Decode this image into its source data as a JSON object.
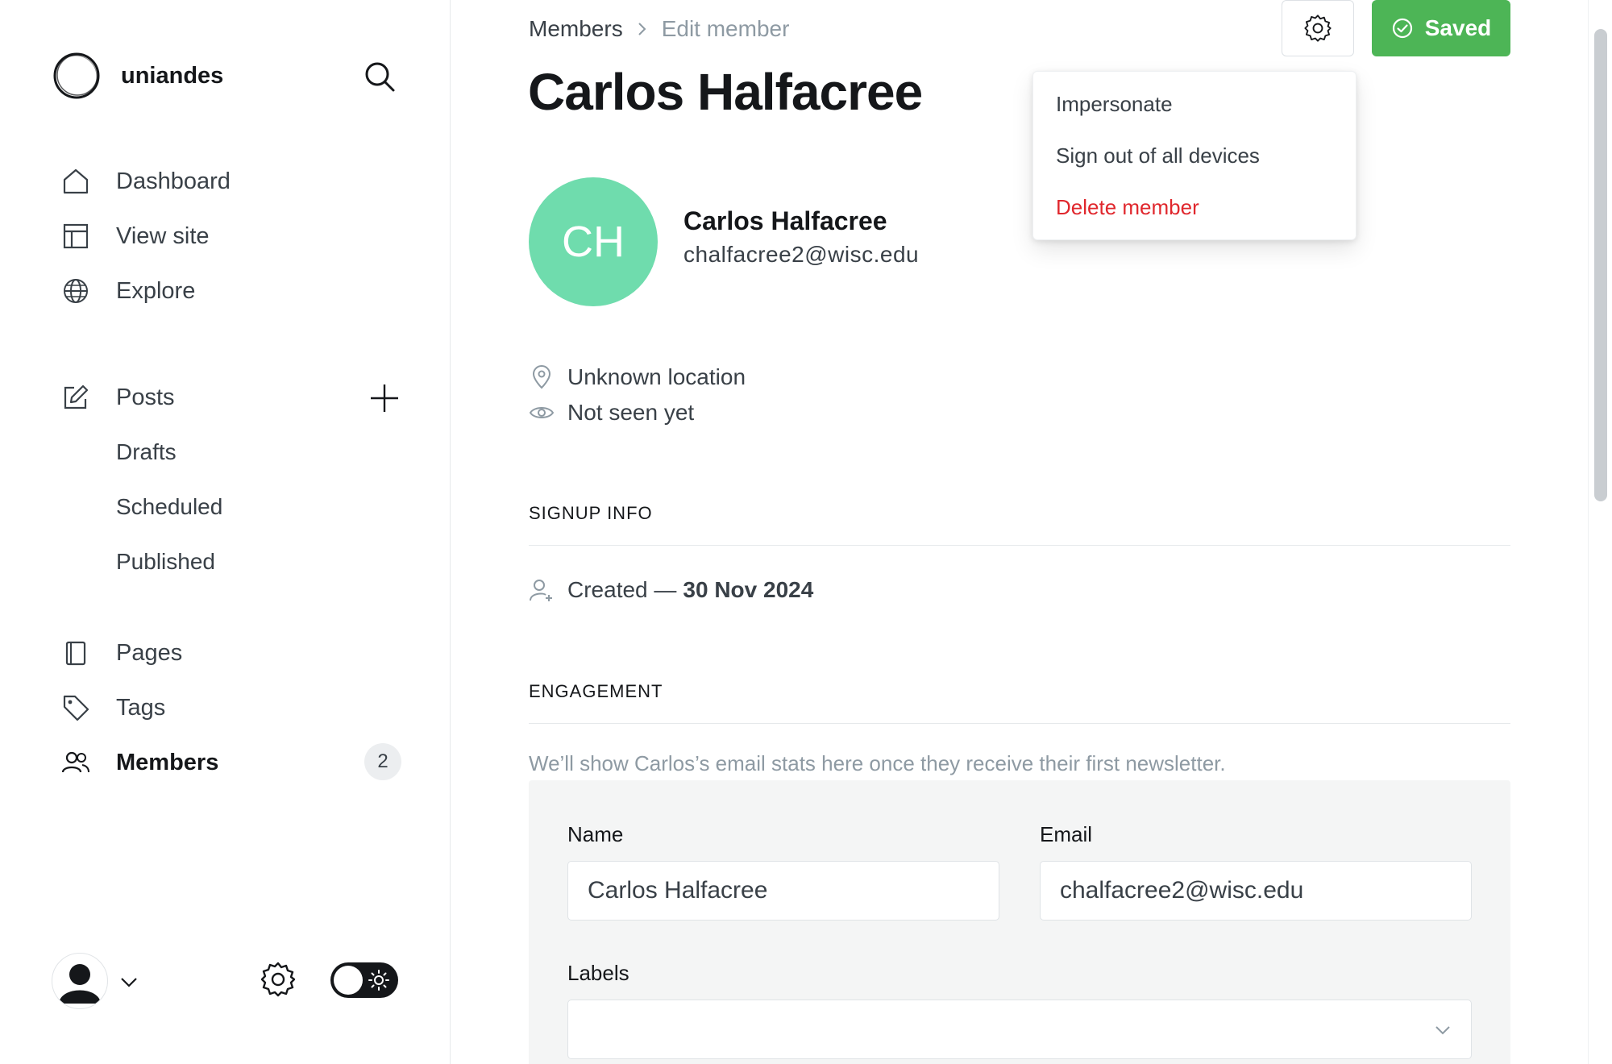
{
  "sidebar": {
    "brand_name": "uniandes",
    "nav": {
      "dashboard": "Dashboard",
      "view_site": "View site",
      "explore": "Explore",
      "posts": "Posts",
      "drafts": "Drafts",
      "scheduled": "Scheduled",
      "published": "Published",
      "pages": "Pages",
      "tags": "Tags",
      "members": "Members",
      "members_count": "2"
    },
    "icons": [
      "search-icon",
      "home-icon",
      "layout-icon",
      "globe-icon",
      "edit-icon",
      "plus-icon",
      "page-icon",
      "tag-icon",
      "users-icon",
      "user-avatar-icon",
      "chevron-down-icon",
      "gear-icon",
      "sun-icon"
    ]
  },
  "header": {
    "breadcrumb": {
      "parent": "Members",
      "current": "Edit member"
    },
    "title": "Carlos Halfacree",
    "saved_label": "Saved"
  },
  "dropdown": {
    "items": [
      "Impersonate",
      "Sign out of all devices",
      "Delete member"
    ]
  },
  "member": {
    "initials": "CH",
    "name": "Carlos Halfacree",
    "email": "chalfacree2@wisc.edu",
    "location": "Unknown location",
    "last_seen": "Not seen yet"
  },
  "signup": {
    "heading": "SIGNUP INFO",
    "created_prefix": "Created —",
    "created_date": "30 Nov 2024"
  },
  "engagement": {
    "heading": "ENGAGEMENT",
    "note": "We’ll show Carlos’s email stats here once they receive their first newsletter."
  },
  "form": {
    "name_label": "Name",
    "name_value": "Carlos Halfacree",
    "email_label": "Email",
    "email_value": "chalfacree2@wisc.edu",
    "labels_label": "Labels",
    "labels_value": ""
  },
  "colors": {
    "accent_green": "#4db556",
    "avatar_green": "#6fdcad",
    "danger_red": "#e0272d",
    "text_dark": "#15171a",
    "text_muted": "#8e9aa3"
  }
}
